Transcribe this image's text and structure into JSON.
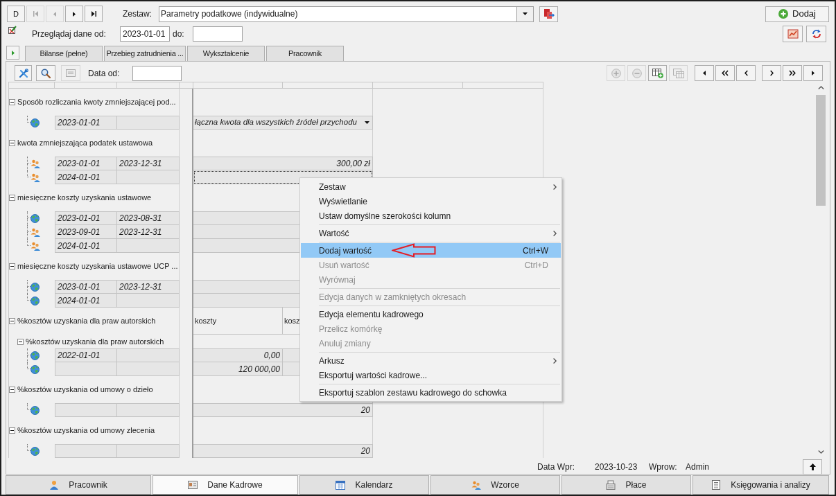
{
  "toolbar": {
    "nav_buttons": [
      {
        "kind": "text",
        "label": "D",
        "disabled": false
      },
      {
        "kind": "first",
        "disabled": true
      },
      {
        "kind": "prev",
        "disabled": true
      },
      {
        "kind": "next",
        "disabled": false
      },
      {
        "kind": "last",
        "disabled": false
      }
    ],
    "set_label": "Zestaw:",
    "set_value": "Parametry podatkowe (indywidualne)",
    "add_button": "Dodaj"
  },
  "filter": {
    "label": "Przeglądaj dane od:",
    "date_from": "2023-01-01",
    "to_label": "do:"
  },
  "tabs": [
    {
      "label": "Bilanse (pełne)",
      "selected": false
    },
    {
      "label": "Przebieg zatrudnienia ...",
      "selected": false
    },
    {
      "label": "Wykształcenie",
      "selected": false
    },
    {
      "label": "Pracownik",
      "selected": false
    }
  ],
  "panel_toolbar": {
    "left_buttons": [
      {
        "kind": "tools",
        "disabled": false
      },
      {
        "kind": "search",
        "disabled": false
      },
      {
        "kind": "card",
        "disabled": true
      }
    ],
    "date_label": "Data od:",
    "right_buttons": [
      {
        "kind": "add",
        "disabled": true
      },
      {
        "kind": "remove",
        "disabled": true
      },
      {
        "kind": "table-add",
        "disabled": false
      },
      {
        "kind": "table-copy",
        "disabled": true
      }
    ],
    "nav_buttons": [
      {
        "kind": "start",
        "disabled": false
      },
      {
        "kind": "rewind",
        "disabled": false
      },
      {
        "kind": "back",
        "disabled": false
      },
      {
        "kind": "forward",
        "disabled": false
      },
      {
        "kind": "fastforward",
        "disabled": false
      },
      {
        "kind": "end",
        "disabled": false
      }
    ]
  },
  "tree": [
    {
      "label": "Sposób rozliczania kwoty zmniejszającej pod...",
      "expanded": true,
      "children": [
        {
          "kind": "globe",
          "date_from": "2023-01-01",
          "values": [
            "łączna kwota dla wszystkich źródeł przychodu"
          ],
          "dropdown": true,
          "selected": false
        }
      ]
    },
    {
      "label": "kwota zmniejszająca podatek ustawowa",
      "expanded": true,
      "children": [
        {
          "kind": "people",
          "date_from": "2023-01-01",
          "date_to": "2023-12-31",
          "values": [
            "300,00 zł"
          ],
          "selected": false
        },
        {
          "kind": "people",
          "date_from": "2024-01-01",
          "selected": true
        }
      ]
    },
    {
      "label": "miesięczne koszty uzyskania ustawowe",
      "expanded": true,
      "children": [
        {
          "kind": "globe",
          "date_from": "2023-01-01",
          "date_to": "2023-08-31",
          "selected": false
        },
        {
          "kind": "people",
          "date_from": "2023-09-01",
          "date_to": "2023-12-31",
          "selected": false
        },
        {
          "kind": "people",
          "date_from": "2024-01-01",
          "selected": false
        }
      ]
    },
    {
      "label": "miesięczne koszty uzyskania ustawowe UCP ...",
      "expanded": true,
      "children": [
        {
          "kind": "globe",
          "date_from": "2023-01-01",
          "date_to": "2023-12-31",
          "selected": false
        },
        {
          "kind": "globe",
          "date_from": "2024-01-01",
          "selected": false
        }
      ]
    },
    {
      "label": "%kosztów uzyskania dla praw autorskich",
      "expanded": true,
      "headers": [
        "koszty",
        "kosz"
      ],
      "children": [
        {
          "label": "%kosztów uzyskania dla praw autorskich",
          "expanded": true,
          "children": [
            {
              "kind": "globe",
              "date_from": "2022-01-01",
              "values": [
                "0,00"
              ],
              "selected": false
            },
            {
              "kind": "globe",
              "values": [
                "120 000,00"
              ],
              "selected": false
            }
          ]
        }
      ]
    },
    {
      "label": "%kosztów uzyskania od umowy o dzieło",
      "expanded": true,
      "children": [
        {
          "kind": "globe",
          "values": [
            "20"
          ],
          "selected": false
        }
      ]
    },
    {
      "label": "%kosztów uzyskania od umowy zlecenia",
      "expanded": true,
      "children": [
        {
          "kind": "globe",
          "values": [
            "20"
          ],
          "selected": false
        }
      ]
    }
  ],
  "status": {
    "date_label": "Data Wpr:",
    "date": "2023-10-23",
    "user_label": "Wprow:",
    "user": "Admin"
  },
  "context_menu": {
    "sections": [
      {
        "items": [
          {
            "label": "Zestaw",
            "submenu": true,
            "disabled": false,
            "selected": false
          },
          {
            "label": "Wyświetlanie",
            "submenu": false,
            "disabled": false,
            "selected": false
          },
          {
            "label": "Ustaw domyślne szerokości kolumn",
            "submenu": false,
            "disabled": false,
            "selected": false
          }
        ]
      },
      {
        "items": [
          {
            "label": "Wartość",
            "submenu": true,
            "disabled": false,
            "selected": false
          }
        ]
      },
      {
        "items": [
          {
            "label": "Dodaj wartość",
            "shortcut": "Ctrl+W",
            "submenu": false,
            "disabled": false,
            "selected": true,
            "annotated": true
          },
          {
            "label": "Usuń wartość",
            "shortcut": "Ctrl+D",
            "submenu": false,
            "disabled": true,
            "selected": false
          },
          {
            "label": "Wyrównaj",
            "submenu": false,
            "disabled": true,
            "selected": false
          }
        ]
      },
      {
        "items": [
          {
            "label": "Edycja danych w zamkniętych okresach",
            "submenu": false,
            "disabled": true,
            "selected": false
          }
        ]
      },
      {
        "items": [
          {
            "label": "Edycja elementu kadrowego",
            "submenu": false,
            "disabled": false,
            "selected": false
          },
          {
            "label": "Przelicz komórkę",
            "submenu": false,
            "disabled": true,
            "selected": false
          },
          {
            "label": "Anuluj zmiany",
            "submenu": false,
            "disabled": true,
            "selected": false
          }
        ]
      },
      {
        "items": [
          {
            "label": "Arkusz",
            "submenu": true,
            "disabled": false,
            "selected": false
          },
          {
            "label": "Eksportuj wartości kadrowe...",
            "submenu": false,
            "disabled": false,
            "selected": false
          }
        ]
      },
      {
        "items": [
          {
            "label": "Eksportuj szablon zestawu kadrowego do schowka",
            "submenu": false,
            "disabled": false,
            "selected": false
          }
        ]
      }
    ]
  },
  "bottom_tabs": [
    {
      "kind": "person",
      "label": "Pracownik",
      "selected": false
    },
    {
      "kind": "card",
      "label": "Dane Kadrowe",
      "selected": true
    },
    {
      "kind": "calendar",
      "label": "Kalendarz",
      "selected": false
    },
    {
      "kind": "people",
      "label": "Wzorce",
      "selected": false
    },
    {
      "kind": "register",
      "label": "Płace",
      "selected": false
    },
    {
      "kind": "ledger",
      "label": "Księgowania i analizy",
      "selected": false
    }
  ]
}
